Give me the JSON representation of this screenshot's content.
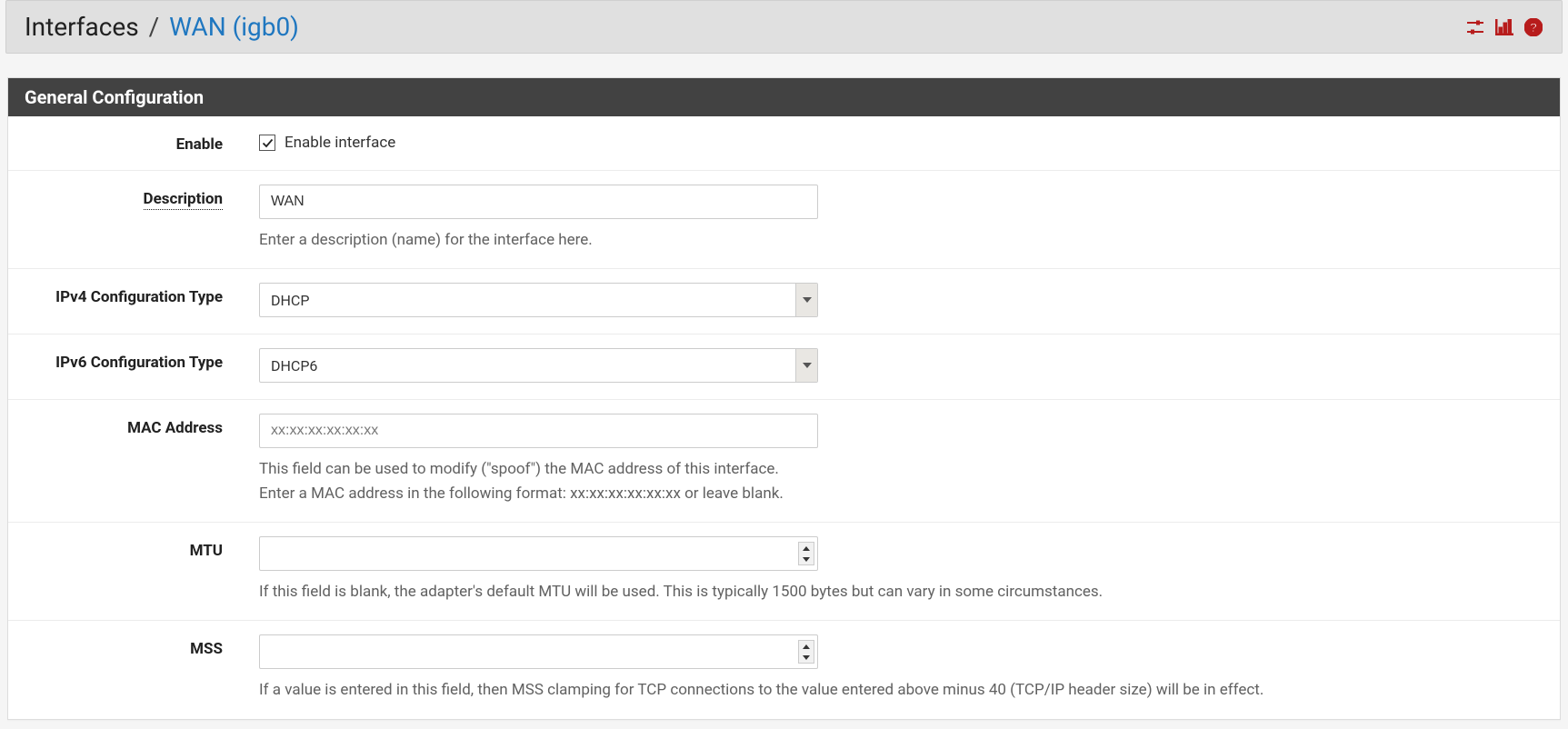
{
  "breadcrumb": {
    "root": "Interfaces",
    "sep": "/",
    "current": "WAN (igb0)"
  },
  "panel": {
    "title": "General Configuration"
  },
  "fields": {
    "enable": {
      "label": "Enable",
      "checkbox_label": "Enable interface",
      "checked": true
    },
    "description": {
      "label": "Description",
      "value": "WAN",
      "help": "Enter a description (name) for the interface here."
    },
    "ipv4": {
      "label": "IPv4 Configuration Type",
      "value": "DHCP"
    },
    "ipv6": {
      "label": "IPv6 Configuration Type",
      "value": "DHCP6"
    },
    "mac": {
      "label": "MAC Address",
      "placeholder": "xx:xx:xx:xx:xx:xx",
      "value": "",
      "help_line1": "This field can be used to modify (\"spoof\") the MAC address of this interface.",
      "help_line2": "Enter a MAC address in the following format: xx:xx:xx:xx:xx:xx or leave blank."
    },
    "mtu": {
      "label": "MTU",
      "value": "",
      "help": "If this field is blank, the adapter's default MTU will be used. This is typically 1500 bytes but can vary in some circumstances."
    },
    "mss": {
      "label": "MSS",
      "value": "",
      "help": "If a value is entered in this field, then MSS clamping for TCP connections to the value entered above minus 40 (TCP/IP header size) will be in effect."
    }
  }
}
